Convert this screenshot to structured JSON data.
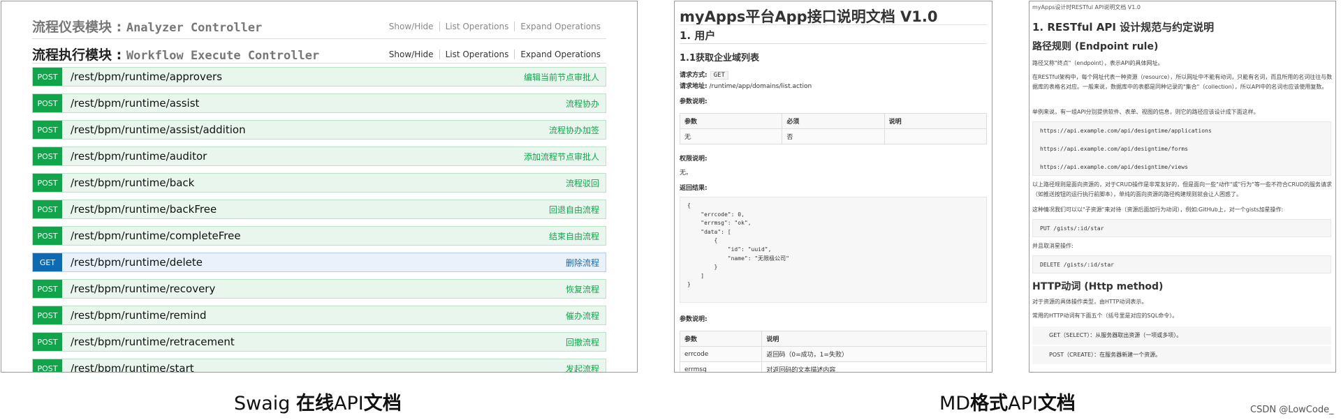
{
  "swagger": {
    "header1": {
      "cn": "流程仪表模块 : ",
      "en": "Analyzer Controller"
    },
    "header2": {
      "cn": "流程执行模块 : ",
      "en": "Workflow Execute Controller"
    },
    "ops": [
      "Show/Hide",
      "List Operations",
      "Expand Operations"
    ],
    "rows": [
      {
        "method": "POST",
        "path": "/rest/bpm/runtime/approvers",
        "desc": "编辑当前节点审批人"
      },
      {
        "method": "POST",
        "path": "/rest/bpm/runtime/assist",
        "desc": "流程协办"
      },
      {
        "method": "POST",
        "path": "/rest/bpm/runtime/assist/addition",
        "desc": "流程协办加签"
      },
      {
        "method": "POST",
        "path": "/rest/bpm/runtime/auditor",
        "desc": "添加流程节点审批人"
      },
      {
        "method": "POST",
        "path": "/rest/bpm/runtime/back",
        "desc": "流程驳回"
      },
      {
        "method": "POST",
        "path": "/rest/bpm/runtime/backFree",
        "desc": "回退自由流程"
      },
      {
        "method": "POST",
        "path": "/rest/bpm/runtime/completeFree",
        "desc": "结束自由流程"
      },
      {
        "method": "GET",
        "path": "/rest/bpm/runtime/delete",
        "desc": "删除流程"
      },
      {
        "method": "POST",
        "path": "/rest/bpm/runtime/recovery",
        "desc": "恢复流程"
      },
      {
        "method": "POST",
        "path": "/rest/bpm/runtime/remind",
        "desc": "催办流程"
      },
      {
        "method": "POST",
        "path": "/rest/bpm/runtime/retracement",
        "desc": "回撤流程"
      },
      {
        "method": "POST",
        "path": "/rest/bpm/runtime/start",
        "desc": "发起流程"
      }
    ]
  },
  "md1": {
    "title": "myApps平台App接口说明文档 V1.0",
    "h2": "1. 用户",
    "h3": "1.1获取企业域列表",
    "req_method_label": "请求方式:",
    "req_method": "GET",
    "req_addr_label": "请求地址:",
    "req_addr": "/runtime/app/domains/list.action",
    "params_label": "参数说明:",
    "params_headers": [
      "参数",
      "必须",
      "说明"
    ],
    "params_row": [
      "无",
      "否",
      ""
    ],
    "perm_label": "权限说明:",
    "perm_text": "无。",
    "result_label": "返回结果:",
    "result_code": "{\n    \"errcode\": 0,\n    \"errmsg\": \"ok\",\n    \"data\": [\n        {\n            \"id\": \"uuid\",\n            \"name\": \"无限极公司\"\n        }\n    ]\n}",
    "params2_label": "参数说明:",
    "params2_headers": [
      "参数",
      "说明"
    ],
    "params2_rows": [
      [
        "errcode",
        "返回码（0=成功，1=失败）"
      ],
      [
        "errmsg",
        "对返回码的文本描述内容"
      ]
    ]
  },
  "md2": {
    "top": "myApps设计时RESTful API说明文档 V1.0",
    "h1": "1. RESTful API 设计规范与约定说明",
    "h2a": "路径规则 (Endpoint rule)",
    "p1": "路径又称\"终点\"（endpoint），表示API的具体网址。",
    "p2": "在RESTful架构中，每个网址代表一种资源（resource），所以网址中不能有动词，只能有名词，而且所用的名词往往与数据库的表格名对应。一般来说，数据库中的表都是同种记录的\"集合\"（collection），所以API中的名词也应该使用复数。",
    "p3": "举例来说，有一组API分别提供软件、表单、视图的信息，则它的路径应该设计成下面这样。",
    "urls": [
      "https://api.example.com/api/designtime/applications",
      "https://api.example.com/api/designtime/forms",
      "https://api.example.com/api/designtime/views"
    ],
    "p4": "以上路径规则是面向资源的，对于CRUD操作是非常友好的，但是面向一些\"动作\"或\"行为\"等一些不符合CRUD的服务请求（如推送按钮的运行执行前脚本），单纯的面向资源的路径构建规则就会让人困惑了。",
    "p5": "这种情况我们可以以\"子资源\"来对待（资源后面加行为动词），例如:GitHub上，对一个gists加星操作:",
    "code1": "PUT /gists/:id/star",
    "p6": "并且取消星操作:",
    "code2": "DELETE /gists/:id/star",
    "h2b": "HTTP动词 (Http method)",
    "p7": "对于资源的具体操作类型，由HTTP动词表示。",
    "p8": "常用的HTTP动词有下面五个（括号里是对应的SQL命令）。",
    "verbs": [
      "GET（SELECT）：从服务器取出资源（一项或多项）。",
      "POST（CREATE）：在服务器新建一个资源。"
    ]
  },
  "captions": {
    "left_a": "Swaig ",
    "left_b": "在线",
    "left_c": "API",
    "left_d": "文档",
    "right_a": "MD",
    "right_b": "格式",
    "right_c": "API",
    "right_d": "文档"
  },
  "credit": "CSDN @LowCode_"
}
